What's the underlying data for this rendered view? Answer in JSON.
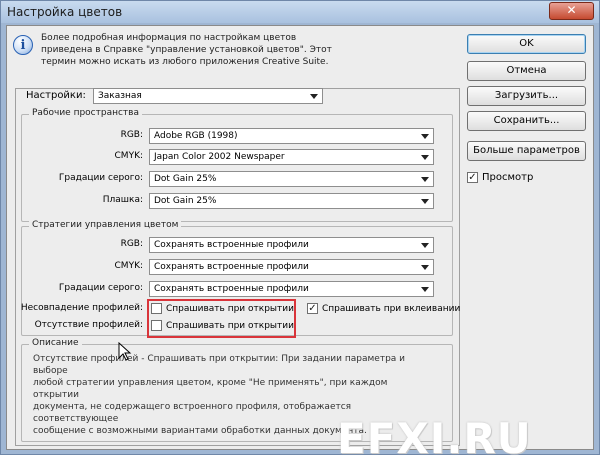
{
  "window": {
    "title": "Настройка цветов",
    "close_glyph": "✕"
  },
  "info": {
    "icon": "info-icon",
    "icon_glyph": "i",
    "lines": [
      "Более подробная информация по настройкам цветов",
      "приведена в Справке \"управление установкой цветов\". Этот",
      "термин можно искать из любого приложения Creative Suite."
    ]
  },
  "buttons": {
    "ok": "OK",
    "cancel": "Отмена",
    "load": "Загрузить...",
    "save": "Сохранить...",
    "more": "Больше параметров"
  },
  "preview": {
    "label": "Просмотр",
    "checked": true,
    "check_glyph": "✓"
  },
  "settings": {
    "label": "Настройки:",
    "value": "Заказная"
  },
  "working_spaces": {
    "title": "Рабочие пространства",
    "rows": [
      {
        "label": "RGB:",
        "value": "Adobe RGB (1998)"
      },
      {
        "label": "CMYK:",
        "value": "Japan Color 2002 Newspaper"
      },
      {
        "label": "Градации серого:",
        "value": "Dot Gain 25%"
      },
      {
        "label": "Плашка:",
        "value": "Dot Gain 25%"
      }
    ]
  },
  "policies": {
    "title": "Стратегии управления цветом",
    "rows": [
      {
        "label": "RGB:",
        "value": "Сохранять встроенные профили"
      },
      {
        "label": "CMYK:",
        "value": "Сохранять встроенные профили"
      },
      {
        "label": "Градации серого:",
        "value": "Сохранять встроенные профили"
      }
    ],
    "mismatch_label": "Несовпадение профилей:",
    "mismatch_open": {
      "label": "Спрашивать при открытии",
      "checked": false
    },
    "mismatch_paste": {
      "label": "Спрашивать при вклеивании",
      "checked": true
    },
    "missing_label": "Отсутствие профилей:",
    "missing_open": {
      "label": "Спрашивать при открытии",
      "checked": false
    }
  },
  "description": {
    "title": "Описание",
    "lines": [
      "Отсутствие профилей - Спрашивать при открытии:  При задании параметра и выборе",
      "любой стратегии управления цветом, кроме \"Не применять\", при каждом открытии",
      "документа, не содержащего встроенного профиля, отображается соответствующее",
      "сообщение с возможными вариантами обработки данных документа."
    ]
  },
  "watermark": "EFXI.RU",
  "colors": {
    "highlight": "#d9343a",
    "titlebar": "#a9c1df",
    "default_button_border": "#3c7fb1"
  }
}
